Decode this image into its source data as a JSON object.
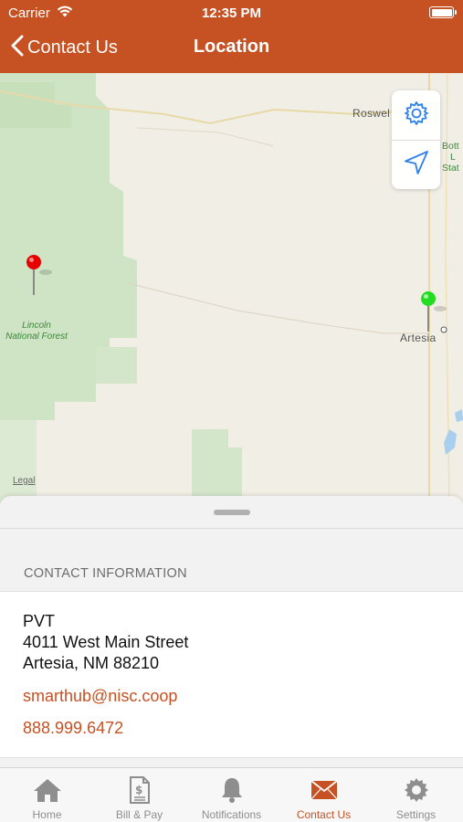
{
  "status_bar": {
    "carrier": "Carrier",
    "time": "12:35 PM"
  },
  "nav": {
    "back_label": "Contact Us",
    "title": "Location"
  },
  "map": {
    "labels": {
      "roswell": "Roswel",
      "artesia": "Artesia",
      "forest_line1": "Lincoln",
      "forest_line2": "National Forest",
      "park_line1": "Bott",
      "park_line2": "L",
      "park_line3": "Stat",
      "legal": "Legal"
    },
    "controls": {
      "settings_icon": "gear-icon",
      "location_icon": "location-arrow-icon"
    },
    "pins": [
      {
        "color": "#e60000"
      },
      {
        "color": "#22dd22"
      }
    ]
  },
  "contact": {
    "section_title": "CONTACT INFORMATION",
    "name": "PVT",
    "address_line1": "4011 West Main Street",
    "address_line2": "Artesia, NM 88210",
    "email": "smarthub@nisc.coop",
    "phone": "888.999.6472"
  },
  "tabs": [
    {
      "label": "Home",
      "icon": "home-icon"
    },
    {
      "label": "Bill & Pay",
      "icon": "bill-icon"
    },
    {
      "label": "Notifications",
      "icon": "bell-icon"
    },
    {
      "label": "Contact Us",
      "icon": "envelope-icon",
      "active": true
    },
    {
      "label": "Settings",
      "icon": "gear-icon"
    }
  ],
  "colors": {
    "brand": "#c65123",
    "inactive_tab": "#8e8e8e"
  }
}
